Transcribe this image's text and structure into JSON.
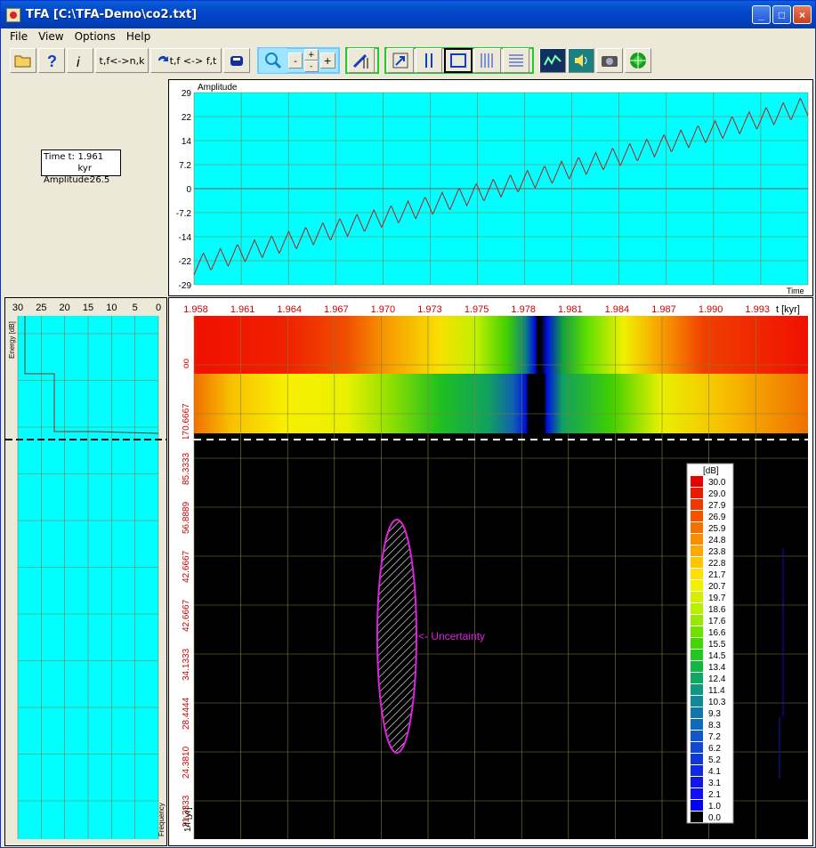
{
  "window": {
    "title": "TFA [C:\\TFA-Demo\\co2.txt]",
    "controls": [
      "_",
      "□",
      "×"
    ]
  },
  "menu": [
    "File",
    "View",
    "Options",
    "Help"
  ],
  "toolbar": {
    "btn_nk": "t,f<->n,k",
    "btn_ft": "t,f <-> f,t",
    "zoom_minus": "-",
    "zoom_plus": "+",
    "small_plus": "+",
    "small_minus": "-",
    "icons": [
      "open-folder-icon",
      "help-icon",
      "info-icon",
      "swap-icon",
      "car-icon",
      "zoom-icon",
      "cursor-icon",
      "arrow-icon",
      "bars-icon",
      "frame-icon",
      "vlines-icon",
      "hlines-icon",
      "chart-icon",
      "speaker-icon",
      "camera-icon",
      "target-icon"
    ]
  },
  "readout": {
    "time_label": "Time t:",
    "time_value": "1.961 kyr",
    "amp_label": "Amplitude:",
    "amp_value": "26.5"
  },
  "signal_chart": {
    "title": "Amplitude",
    "xlabel": "Time",
    "yticks": [
      "29",
      "22",
      "14",
      "7.2",
      "0",
      "-7.2",
      "-14",
      "-22",
      "-29"
    ]
  },
  "energy_chart": {
    "ylabel": "Energy [dB]",
    "xlabel": "Frequency",
    "xticks": [
      "30",
      "25",
      "20",
      "15",
      "10",
      "5",
      "0"
    ]
  },
  "spectrogram": {
    "xticks": [
      "1.958",
      "1.961",
      "1.964",
      "1.967",
      "1.970",
      "1.973",
      "1.975",
      "1.978",
      "1.981",
      "1.984",
      "1.987",
      "1.990",
      "1.993"
    ],
    "xlabel": "t [kyr]",
    "yticks": [
      "oo",
      "170.6667",
      "85.3333",
      "56.8889",
      "42.6667",
      "42.6667",
      "34.1333",
      "28.4444",
      "24.3810",
      "21.3333"
    ],
    "ylabel": "1/f [yr]",
    "uncertainty_label": "<- Uncertainty"
  },
  "colorbar": {
    "title": "[dB]",
    "labels": [
      "30.0",
      "29.0",
      "27.9",
      "26.9",
      "25.9",
      "24.8",
      "23.8",
      "22.8",
      "21.7",
      "20.7",
      "19.7",
      "18.6",
      "17.6",
      "16.6",
      "15.5",
      "14.5",
      "13.4",
      "12.4",
      "11.4",
      "10.3",
      "9.3",
      "8.3",
      "7.2",
      "6.2",
      "5.2",
      "4.1",
      "3.1",
      "2.1",
      "1.0",
      "0.0"
    ],
    "colors": [
      "#e60000",
      "#ea1a00",
      "#ee3800",
      "#f25500",
      "#f67000",
      "#f98c00",
      "#fca800",
      "#ffc400",
      "#ffe000",
      "#f0f000",
      "#d4f000",
      "#b8ee00",
      "#98e800",
      "#70e000",
      "#40d800",
      "#20c820",
      "#10b840",
      "#10a860",
      "#109880",
      "#108898",
      "#1078a8",
      "#1068b8",
      "#1058c8",
      "#1048d0",
      "#1038d8",
      "#1028e0",
      "#1018e8",
      "#1010f0",
      "#0000f8",
      "#000000"
    ]
  }
}
